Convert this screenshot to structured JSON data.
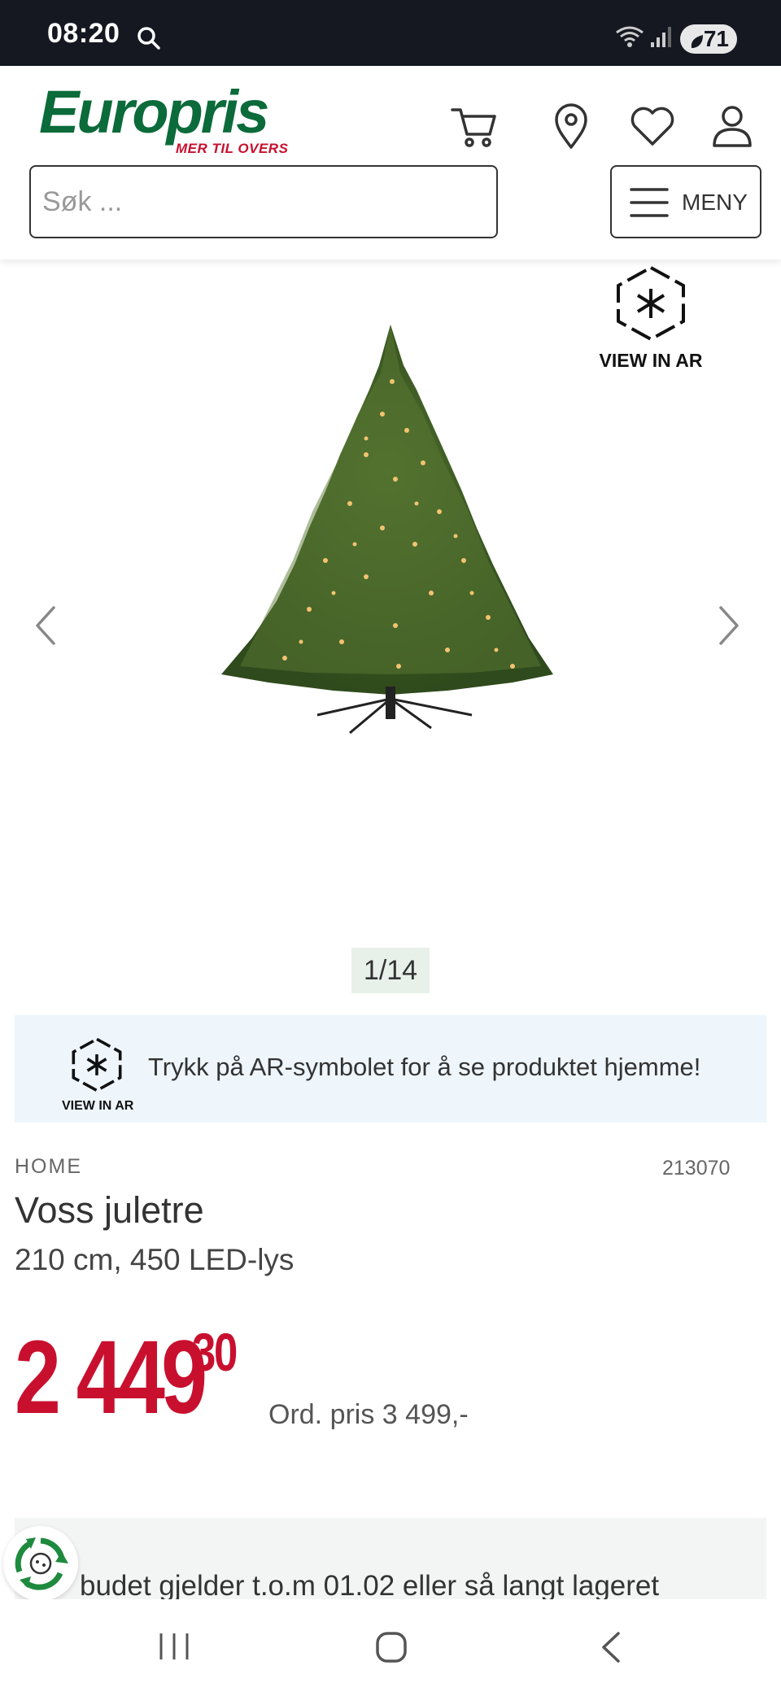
{
  "status_bar": {
    "time": "08:20",
    "battery": "71",
    "wifi_label": "5"
  },
  "header": {
    "brand": "Europris",
    "tagline": "MER TIL OVERS",
    "search_placeholder": "Søk ...",
    "menu_label": "MENY",
    "icons": [
      "cart-icon",
      "location-pin-icon",
      "heart-icon",
      "user-icon",
      "hamburger-icon"
    ]
  },
  "gallery": {
    "ar_label": "VIEW IN AR",
    "counter": "1/14",
    "prev": "chevron-left-icon",
    "next": "chevron-right-icon"
  },
  "ar_banner": {
    "ar_label": "VIEW IN AR",
    "message": "Trykk på AR-symbolet for å se produktet hjemme!"
  },
  "product": {
    "category": "HOME",
    "sku": "213070",
    "name": "Voss juletre",
    "subtitle": "210 cm, 450 LED-lys",
    "price_main": "2 449",
    "price_cents": "30",
    "ord_price": "Ord. pris 3 499,-",
    "offer_text": "budet gjelder t.o.m 01.02 eller så langt lageret"
  },
  "colors": {
    "brand_green": "#0b6b3a",
    "brand_red": "#c8102e",
    "status_bar": "#151821"
  }
}
